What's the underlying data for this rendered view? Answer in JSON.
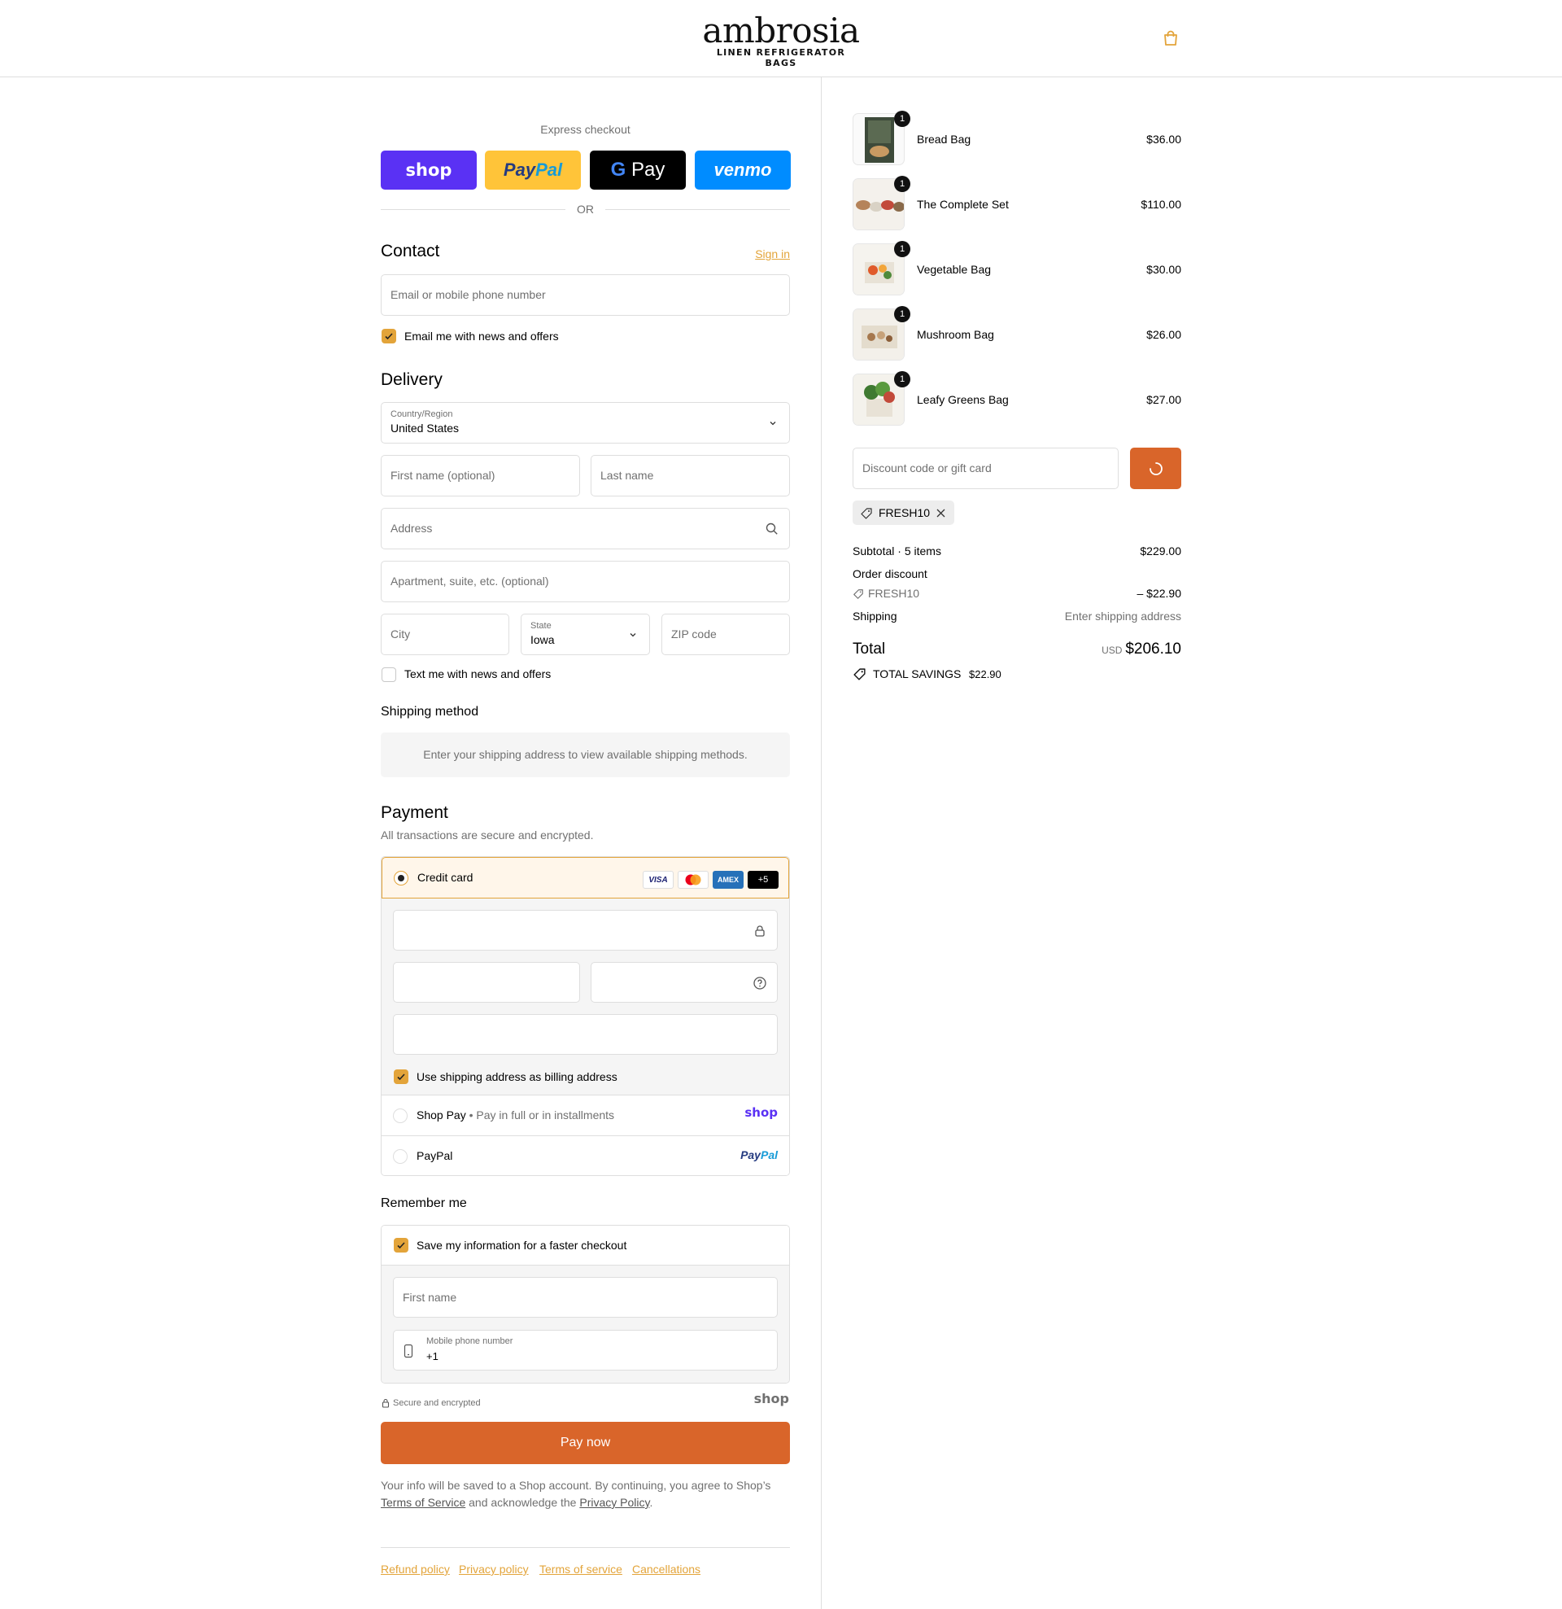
{
  "brand": {
    "name": "ambrosia",
    "tagline": "LINEN REFRIGERATOR BAGS"
  },
  "express": {
    "title": "Express checkout",
    "shop": "shop",
    "paypal_a": "Pay",
    "paypal_b": "Pal",
    "gpay_g": "G",
    "gpay": "Pay",
    "venmo": "venmo",
    "or": "OR"
  },
  "contact": {
    "heading": "Contact",
    "sign_in": "Sign in",
    "email_placeholder": "Email or mobile phone number",
    "news_label": "Email me with news and offers",
    "news_checked": true
  },
  "delivery": {
    "heading": "Delivery",
    "country_label": "Country/Region",
    "country_value": "United States",
    "first_name_ph": "First name (optional)",
    "last_name_ph": "Last name",
    "address_ph": "Address",
    "apartment_ph": "Apartment, suite, etc. (optional)",
    "city_ph": "City",
    "state_label": "State",
    "state_value": "Iowa",
    "zip_ph": "ZIP code",
    "text_label": "Text me with news and offers",
    "text_checked": false
  },
  "shipping_method": {
    "heading": "Shipping method",
    "note": "Enter your shipping address to view available shipping methods."
  },
  "payment": {
    "heading": "Payment",
    "subtitle": "All transactions are secure and encrypted.",
    "credit_card_label": "Credit card",
    "card_badges": [
      "VISA",
      "",
      "AMEX",
      "+5"
    ],
    "billing_label": "Use shipping address as billing address",
    "shop_pay_label": "Shop Pay",
    "shop_pay_sep": "•",
    "shop_pay_desc": "Pay in full or in installments",
    "shop_logo": "shop",
    "paypal_label": "PayPal",
    "paypal_logo_a": "Pay",
    "paypal_logo_b": "Pal"
  },
  "remember": {
    "heading": "Remember me",
    "save_label": "Save my information for a faster checkout",
    "first_name_ph": "First name",
    "phone_label": "Mobile phone number",
    "phone_value": "+1",
    "secure_label": "Secure and encrypted",
    "shop_logo": "shop"
  },
  "pay_button": "Pay now",
  "legal": {
    "line1": "Your info will be saved to a Shop account. By continuing, you agree to Shop’s",
    "terms": "Terms of Service",
    "mid": "and acknowledge the",
    "privacy": "Privacy Policy",
    "end": "."
  },
  "footer_links": [
    "Refund policy",
    "Privacy policy",
    "Terms of service",
    "Cancellations"
  ],
  "cart": {
    "items": [
      {
        "name": "Bread Bag",
        "price": "$36.00",
        "qty": "1"
      },
      {
        "name": "The Complete Set",
        "price": "$110.00",
        "qty": "1"
      },
      {
        "name": "Vegetable Bag",
        "price": "$30.00",
        "qty": "1"
      },
      {
        "name": "Mushroom Bag",
        "price": "$26.00",
        "qty": "1"
      },
      {
        "name": "Leafy Greens Bag",
        "price": "$27.00",
        "qty": "1"
      }
    ],
    "discount_placeholder": "Discount code or gift card",
    "applied_code": "FRESH10",
    "subtotal_label": "Subtotal · 5 items",
    "subtotal": "$229.00",
    "order_discount_label": "Order discount",
    "discount_code": "FRESH10",
    "discount_amount": "– $22.90",
    "shipping_label": "Shipping",
    "shipping_value": "Enter shipping address",
    "total_label": "Total",
    "currency": "USD",
    "total": "$206.10",
    "savings_label": "TOTAL SAVINGS",
    "savings": "$22.90"
  },
  "colors": {
    "accent": "#e3a43a",
    "pay_button": "#d9652a",
    "shop_purple": "#5a31f4",
    "paypal_yellow": "#ffc439",
    "venmo_blue": "#008cff"
  }
}
